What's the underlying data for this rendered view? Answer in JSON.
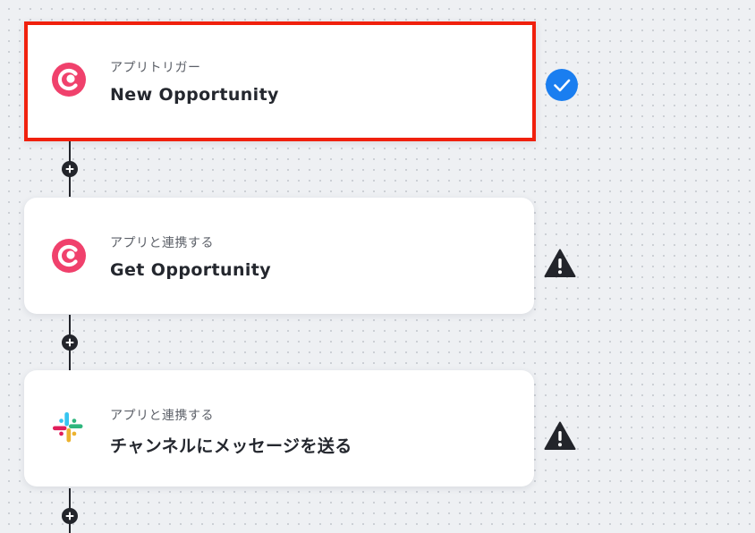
{
  "flow": {
    "steps": [
      {
        "type_label": "アプリトリガー",
        "title": "New Opportunity",
        "app_icon": "copper-logo-icon",
        "status": "success",
        "status_icon": "check-circle-icon"
      },
      {
        "type_label": "アプリと連携する",
        "title": "Get Opportunity",
        "app_icon": "copper-logo-icon",
        "status": "warning",
        "status_icon": "warning-triangle-icon"
      },
      {
        "type_label": "アプリと連携する",
        "title": "チャンネルにメッセージを送る",
        "app_icon": "slack-logo-icon",
        "status": "warning",
        "status_icon": "warning-triangle-icon"
      }
    ],
    "add_step_icon": "plus-icon"
  },
  "colors": {
    "selection_border": "#f0200d",
    "success": "#1a7ef0",
    "warning": "#23252b",
    "copper_brand": "#f0416c",
    "connector": "#23252b"
  }
}
